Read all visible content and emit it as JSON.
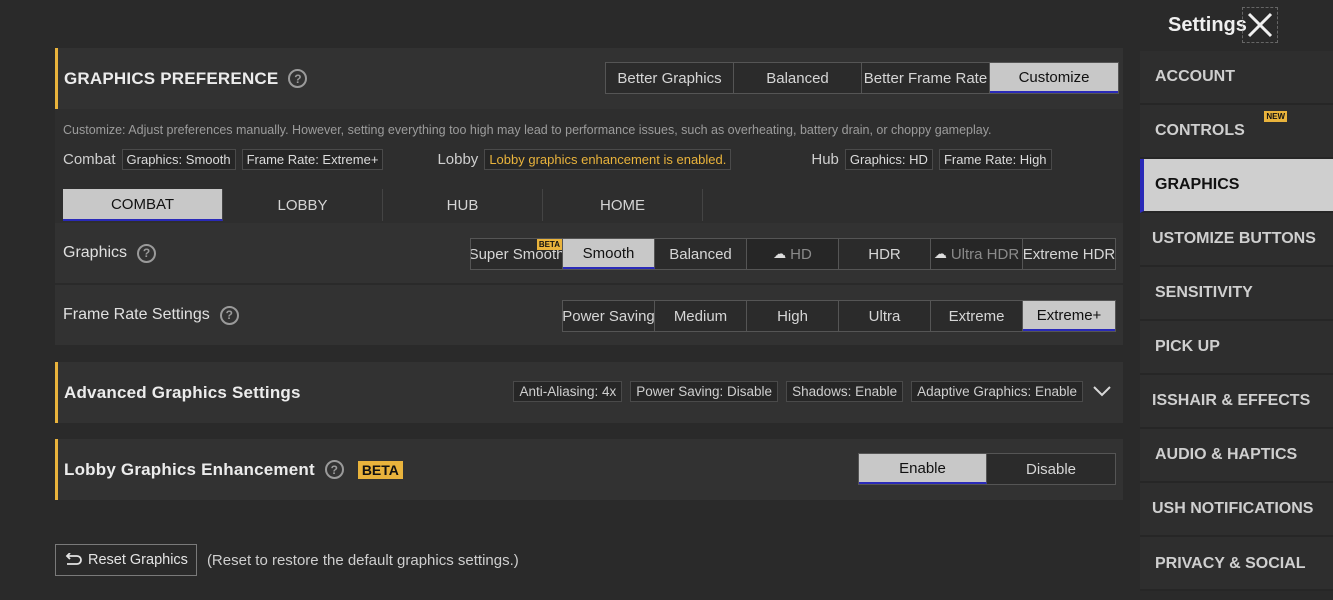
{
  "header": {
    "title": "Settings"
  },
  "preference": {
    "title": "GRAPHICS PREFERENCE",
    "help": "?",
    "options": [
      "Better Graphics",
      "Balanced",
      "Better Frame Rate",
      "Customize"
    ],
    "selected": "Customize",
    "description": "Customize: Adjust preferences manually. However, setting everything too high may lead to performance issues, such as overheating, battery drain, or choppy gameplay."
  },
  "summary": {
    "combat_label": "Combat",
    "combat_graphics": "Graphics: Smooth",
    "combat_framerate": "Frame Rate: Extreme+",
    "lobby_label": "Lobby",
    "lobby_note": "Lobby graphics enhancement is enabled.",
    "hub_label": "Hub",
    "hub_graphics": "Graphics: HD",
    "hub_framerate": "Frame Rate: High"
  },
  "tabs": [
    "COMBAT",
    "LOBBY",
    "HUB",
    "HOME"
  ],
  "graphics": {
    "label": "Graphics",
    "help": "?",
    "options": [
      "Super Smooth",
      "Smooth",
      "Balanced",
      "HD",
      "HDR",
      "Ultra HDR",
      "Extreme HDR"
    ],
    "beta_tag": "BETA",
    "selected": "Smooth"
  },
  "framerate": {
    "label": "Frame Rate Settings",
    "help": "?",
    "options": [
      "Power Saving",
      "Medium",
      "High",
      "Ultra",
      "Extreme",
      "Extreme+"
    ],
    "selected": "Extreme+"
  },
  "advanced": {
    "title": "Advanced Graphics Settings",
    "tags": [
      "Anti-Aliasing: 4x",
      "Power Saving: Disable",
      "Shadows: Enable",
      "Adaptive Graphics: Enable"
    ]
  },
  "lobby_enhancement": {
    "title": "Lobby Graphics Enhancement",
    "help": "?",
    "beta": "BETA",
    "options": [
      "Enable",
      "Disable"
    ],
    "selected": "Enable"
  },
  "reset": {
    "button": "Reset Graphics",
    "note": "(Reset to restore the default graphics settings.)"
  },
  "sidebar": {
    "items": [
      "ACCOUNT",
      "CONTROLS",
      "GRAPHICS",
      "USTOMIZE BUTTONS",
      "SENSITIVITY",
      "PICK UP",
      "ISSHAIR & EFFECTS",
      "AUDIO & HAPTICS",
      "USH NOTIFICATIONS",
      "PRIVACY & SOCIAL"
    ],
    "new_badge": "NEW",
    "selected": "GRAPHICS"
  },
  "colors": {
    "accent": "#e9b33c",
    "selection_underline": "#2a2ab8",
    "background": "#2a2a2a"
  }
}
